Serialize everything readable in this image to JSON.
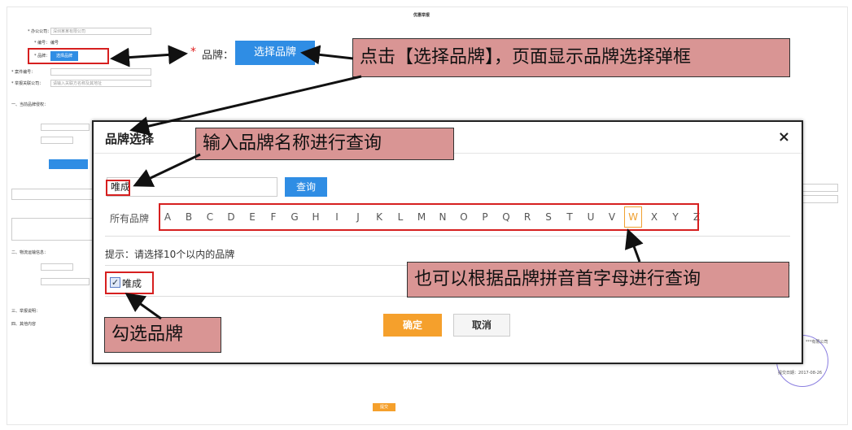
{
  "bg": {
    "title": "优惠举报",
    "rows": [
      {
        "label": "* 办公公司：",
        "value": "深圳某某有限公司"
      },
      {
        "label": "* 编号：",
        "value": "编号"
      },
      {
        "label": "* 品牌：",
        "value": "选择品牌"
      },
      {
        "label": "* 案件编号：",
        "value": ""
      },
      {
        "label": "* 举报关联公司：",
        "value": "请输入关联方名称及其地址"
      }
    ],
    "section1": "一、当前品牌侵权：",
    "section2": "二、物流运输信息：",
    "section3": "三、举报说明：",
    "section4": "四、其他内容",
    "submit_label": "提交",
    "stamp_line1": "***有限公司",
    "stamp_date": "提交日期：2017-08-26"
  },
  "field": {
    "star": "*",
    "label": "品牌：",
    "button": "选择品牌"
  },
  "modal": {
    "title": "品牌选择",
    "close": "×",
    "search_value": "唯成",
    "search_button": "查询",
    "all_brands_label": "所有品牌",
    "letters": [
      "A",
      "B",
      "C",
      "D",
      "E",
      "F",
      "G",
      "H",
      "I",
      "J",
      "K",
      "L",
      "M",
      "N",
      "O",
      "P",
      "Q",
      "R",
      "S",
      "T",
      "U",
      "V",
      "W",
      "X",
      "Y",
      "Z"
    ],
    "active_letter": "W",
    "hint": "提示：请选择10个以内的品牌",
    "brand_option": "唯成",
    "confirm": "确定",
    "cancel": "取消"
  },
  "annotations": {
    "callout_top": "点击【选择品牌】，页面显示品牌选择弹框",
    "callout_search": "输入品牌名称进行查询",
    "callout_pinyin": "也可以根据品牌拼音首字母进行查询",
    "callout_check": "勾选品牌"
  },
  "colors": {
    "primary_blue": "#2f8de4",
    "confirm_orange": "#f5a02c",
    "annotation_red": "#d61f1f",
    "callout_fill": "#d99594"
  }
}
